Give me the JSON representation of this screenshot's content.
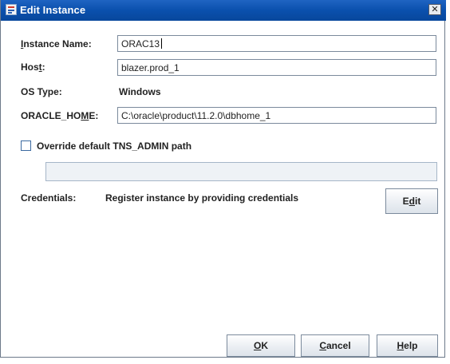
{
  "window": {
    "title": "Edit Instance"
  },
  "form": {
    "instance_name": {
      "label_mnemonic": "I",
      "label_rest": "nstance Name:",
      "value": "ORAC13"
    },
    "host": {
      "label_before": "Hos",
      "label_mnemonic": "t",
      "label_after": ":",
      "value": "blazer.prod_1"
    },
    "os_type": {
      "label": "OS Type:",
      "value": "Windows"
    },
    "oracle_home": {
      "label_before": "ORACLE_HO",
      "label_mnemonic": "M",
      "label_after": "E:",
      "value": "C:\\oracle\\product\\11.2.0\\dbhome_1"
    },
    "override": {
      "label": "Override default TNS_ADMIN path",
      "checked": false,
      "path_value": ""
    },
    "credentials": {
      "label": "Credentials:",
      "value": "Register instance by providing credentials"
    }
  },
  "buttons": {
    "edit": {
      "before": "E",
      "mnemonic": "d",
      "after": "it"
    },
    "ok": {
      "mnemonic": "O",
      "after": "K"
    },
    "cancel": {
      "mnemonic": "C",
      "after": "ancel"
    },
    "help": {
      "mnemonic": "H",
      "after": "elp"
    }
  }
}
